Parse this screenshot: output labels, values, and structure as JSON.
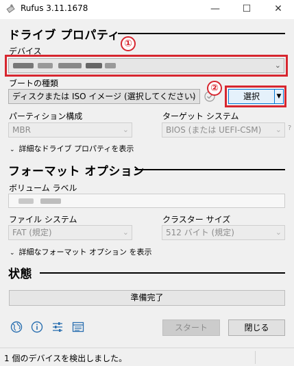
{
  "window": {
    "title": "Rufus 3.11.1678",
    "minimize": "—",
    "maximize": "☐",
    "close": "✕"
  },
  "drive_properties": {
    "heading": "ドライブ プロパティ",
    "device_label": "デバイス",
    "boot_type_label": "ブートの種類",
    "boot_type_value": "ディスクまたは ISO イメージ (選択してください)",
    "select_button": "選択",
    "partition_label": "パーティション構成",
    "partition_value": "MBR",
    "target_label": "ターゲット システム",
    "target_value": "BIOS (または UEFI-CSM)",
    "help_mark": "?",
    "advanced_toggle": "詳細なドライブ プロパティを表示"
  },
  "format_options": {
    "heading": "フォーマット オプション",
    "volume_label": "ボリューム ラベル",
    "fs_label": "ファイル システム",
    "fs_value": "FAT (規定)",
    "cluster_label": "クラスター サイズ",
    "cluster_value": "512 バイト (規定)",
    "advanced_toggle": "詳細なフォーマット オプション を表示"
  },
  "status": {
    "heading": "状態",
    "progress_text": "準備完了"
  },
  "actions": {
    "start": "スタート",
    "close": "閉じる"
  },
  "statusbar": {
    "text": "1 個のデバイスを検出しました。"
  },
  "annotations": {
    "marker_1": "①",
    "marker_2": "②",
    "highlight_color": "#d7262f"
  },
  "icons": [
    "globe-icon",
    "info-icon",
    "settings-sliders-icon",
    "log-icon"
  ]
}
